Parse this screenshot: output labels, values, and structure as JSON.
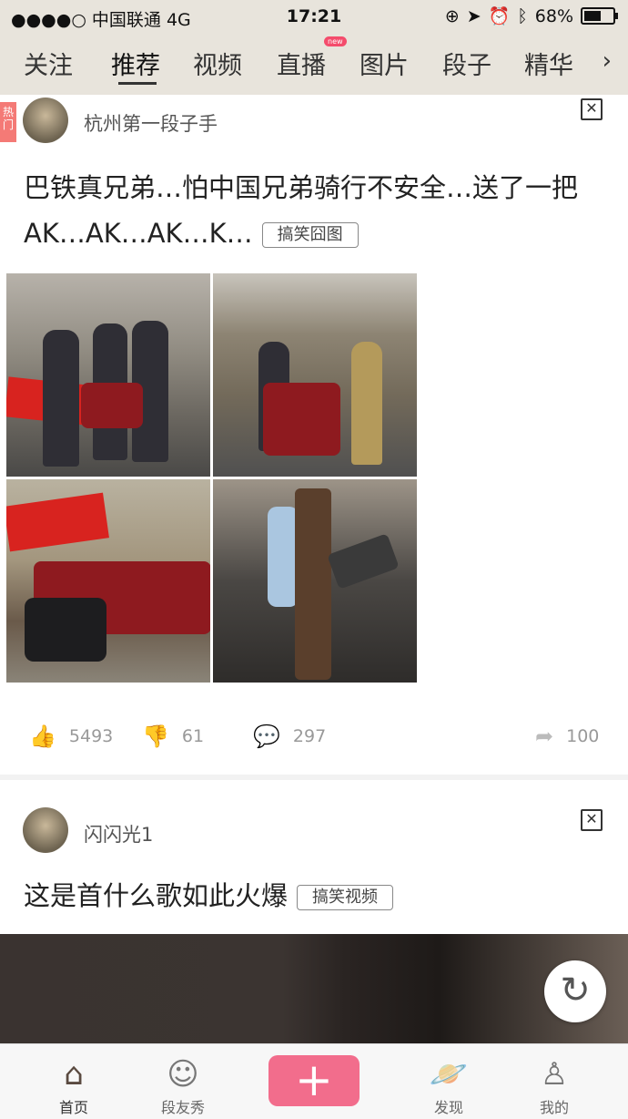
{
  "status_bar": {
    "carrier": "●●●●○ 中国联通  4G",
    "time": "17:21",
    "battery": "68%",
    "battery_level": 0.68
  },
  "tabs": [
    {
      "label": "关注"
    },
    {
      "label": "推荐",
      "active": true
    },
    {
      "label": "视频"
    },
    {
      "label": "直播",
      "badge": "new"
    },
    {
      "label": "图片"
    },
    {
      "label": "段子"
    },
    {
      "label": "精华"
    }
  ],
  "post1": {
    "hot_tag": "热门",
    "username": "杭州第一段子手",
    "text_line1": "巴铁真兄弟…怕中国兄弟骑行不安全…送了一把",
    "text_line2": "AK…AK…AK…K…",
    "category": "搞笑囧图",
    "likes": "5493",
    "dislikes": "61",
    "comments": "297",
    "shares": "100"
  },
  "post2": {
    "username": "闪闪光1",
    "text": "这是首什么歌如此火爆",
    "category": "搞笑视频"
  },
  "bottom_nav": [
    {
      "label": "首页",
      "icon": "home-icon",
      "active": true
    },
    {
      "label": "段友秀",
      "icon": "face-icon"
    },
    {
      "label": "",
      "icon": "plus-icon"
    },
    {
      "label": "发现",
      "icon": "planet-icon"
    },
    {
      "label": "我的",
      "icon": "person-icon"
    }
  ],
  "colors": {
    "accent": "#f26d8c",
    "header_bg": "#e8e4dc",
    "hot_tag": "#f47a76"
  }
}
